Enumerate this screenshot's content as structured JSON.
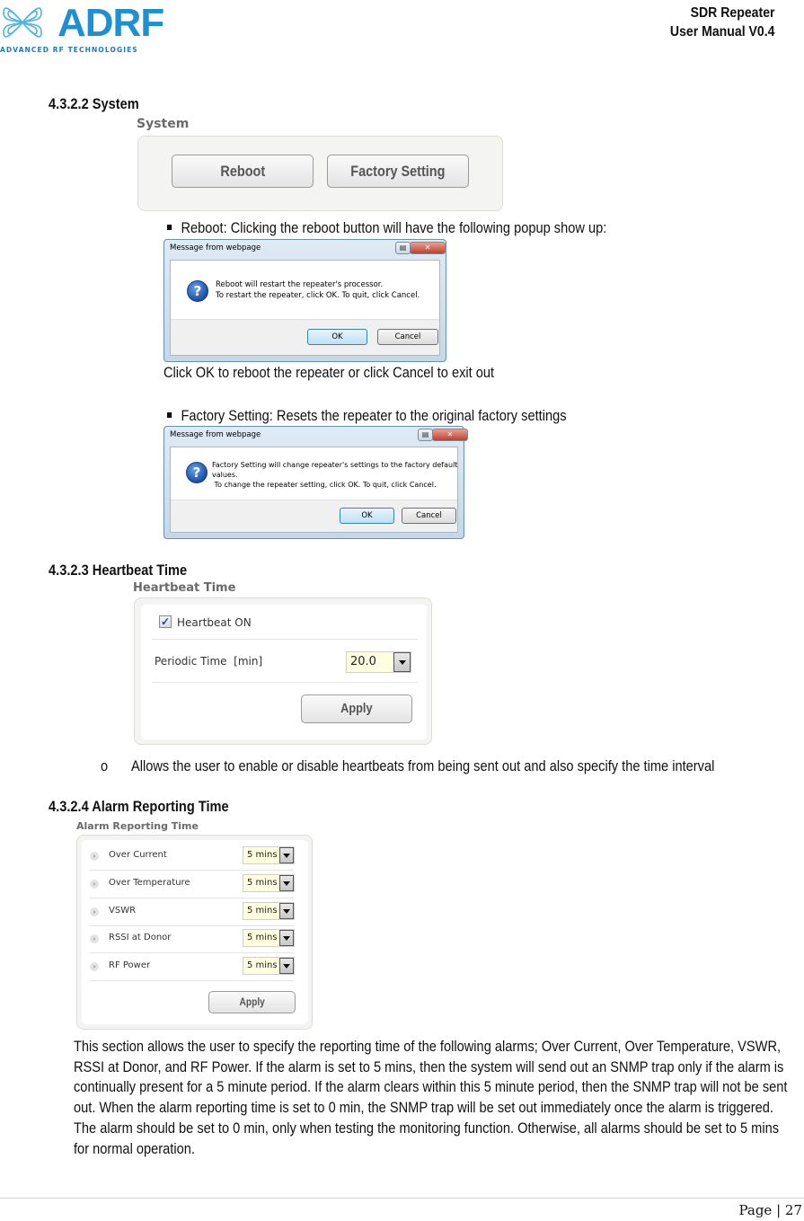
{
  "header": {
    "brand": "ADRF",
    "brand_tagline": "ADVANCED RF TECHNOLOGIES",
    "doc_title": "SDR Repeater",
    "doc_version": "User Manual V0.4",
    "brand_color": "#1e8fd0"
  },
  "sections": {
    "system": {
      "heading": "4.3.2.2 System",
      "panel_title": "System",
      "buttons": {
        "reboot": "Reboot",
        "factory": "Factory Setting"
      },
      "reboot_bullet": "Reboot: Clicking the reboot button will have the following popup show up:",
      "reboot_dialog": {
        "title": "Message from webpage",
        "line1": "Reboot will restart the repeater's processor.",
        "line2": "To restart the repeater, click OK. To quit, click Cancel.",
        "ok": "OK",
        "cancel": "Cancel",
        "restore_icon": "restore-icon",
        "close_icon": "close-icon"
      },
      "reboot_note": "Click OK to reboot the repeater or click Cancel to exit out",
      "factory_bullet": "Factory Setting: Resets the repeater to the original factory settings",
      "factory_dialog": {
        "title": "Message from webpage",
        "line1": "Factory Setting will change repeater's settings to the factory default",
        "line2": "values.",
        "line3": " To change the repeater setting, click OK. To quit, click Cancel.",
        "ok": "OK",
        "cancel": "Cancel"
      }
    },
    "heartbeat": {
      "heading": "4.3.2.3 Heartbeat Time",
      "panel_title": "Heartbeat Time",
      "checkbox_label": "Heartbeat ON",
      "checkbox_checked": true,
      "periodic_label": "Periodic Time  [min]",
      "periodic_value": "20.0",
      "apply": "Apply",
      "bullet_marker": "o",
      "description": "Allows the user to enable or disable heartbeats from being sent out and also specify the time interval"
    },
    "alarm": {
      "heading": "4.3.2.4 Alarm Reporting Time",
      "panel_title": "Alarm Reporting Time",
      "rows": [
        {
          "label": "Over Current",
          "value": "5 mins"
        },
        {
          "label": "Over Temperature",
          "value": "5 mins"
        },
        {
          "label": "VSWR",
          "value": "5 mins"
        },
        {
          "label": "RSSI at Donor",
          "value": "5 mins"
        },
        {
          "label": "RF Power",
          "value": "5 mins"
        }
      ],
      "apply": "Apply",
      "description": "This section allows the user to specify the reporting time of the following alarms; Over Current, Over Temperature, VSWR, RSSI at Donor, and RF Power.   If the alarm is set to 5 mins, then the system will send out an SNMP trap only if the alarm is continually present for a 5 minute period.   If the alarm clears within this 5 minute period, then the SNMP trap will not be sent out.   When the alarm reporting time is set to 0 min, the SNMP trap will be set out immediately once the alarm is triggered.   The alarm should be set to 0 min, only when testing the monitoring function.   Otherwise, all alarms should be set to 5 mins for normal operation."
    }
  },
  "footer": {
    "page_label": "Page | 27"
  }
}
